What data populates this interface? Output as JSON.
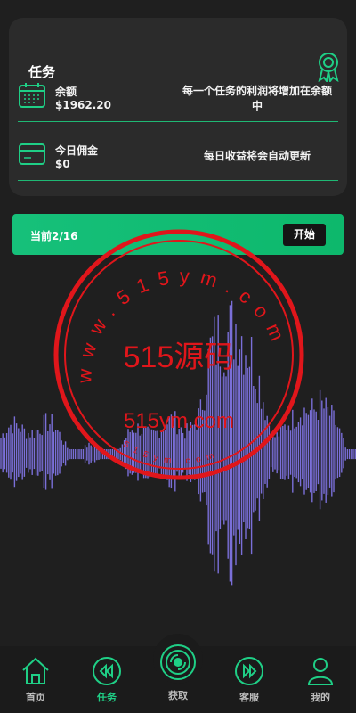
{
  "task_card": {
    "title": "任务",
    "balance": {
      "label": "余额",
      "value": "$1962.20",
      "description": "每一个任务的利润将增加在余额中"
    },
    "commission": {
      "label": "今日佣金",
      "value": "$0",
      "description": "每日收益将会自动更新"
    }
  },
  "progress": {
    "label": "当前2/16",
    "current": 2,
    "total": 16,
    "start_label": "开始"
  },
  "watermark": {
    "url_ring": "www.515ym.com",
    "center_text": "515源码",
    "site_text": "515ym.com",
    "inner_text": "515ym.com"
  },
  "tabbar": {
    "items": [
      {
        "label": "首页",
        "icon": "home-icon"
      },
      {
        "label": "任务",
        "icon": "rewind-icon"
      },
      {
        "label": "获取",
        "icon": "disc-icon"
      },
      {
        "label": "客服",
        "icon": "fast-forward-icon"
      },
      {
        "label": "我的",
        "icon": "user-icon"
      }
    ],
    "active_index": 1
  },
  "colors": {
    "accent": "#1fcf86",
    "background": "#1f1f1f",
    "card": "#2b2b2b",
    "wave": "#7a6fd8",
    "stamp": "#e0161b"
  }
}
